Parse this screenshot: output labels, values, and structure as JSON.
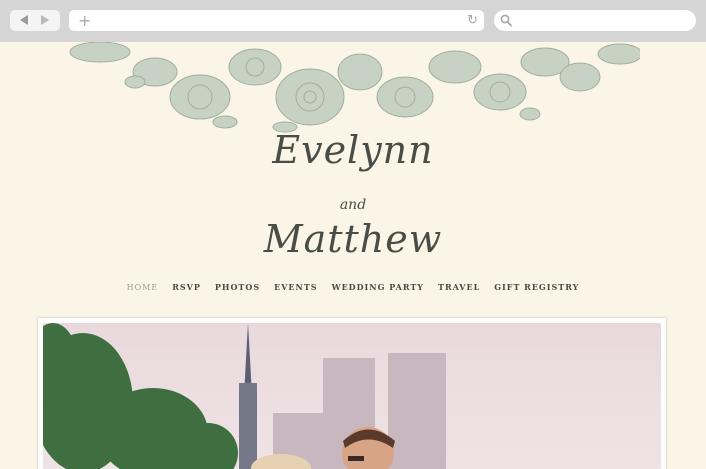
{
  "browser": {
    "back_icon": "back-arrow-icon",
    "forward_icon": "forward-arrow-icon",
    "new_tab_glyph": "+",
    "reload_glyph": "↻",
    "search_icon": "magnifier-icon"
  },
  "site": {
    "name_first": "Evelynn",
    "and_text": "and",
    "name_second": "Matthew",
    "nav": [
      {
        "label": "HOME",
        "active": true
      },
      {
        "label": "RSVP",
        "active": false
      },
      {
        "label": "PHOTOS",
        "active": false
      },
      {
        "label": "EVENTS",
        "active": false
      },
      {
        "label": "WEDDING PARTY",
        "active": false
      },
      {
        "label": "TRAVEL",
        "active": false
      },
      {
        "label": "GIFT REGISTRY",
        "active": false
      }
    ]
  },
  "colors": {
    "page_background": "#fbf5e7",
    "floral": "#b9c6b8",
    "text": "#4a4d45",
    "nav_active": "#9a9d8c"
  }
}
